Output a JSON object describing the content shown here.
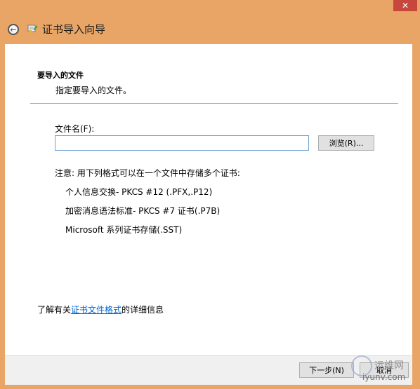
{
  "window": {
    "close_glyph": "✕"
  },
  "header": {
    "title": "证书导入向导",
    "back_glyph": "←"
  },
  "section": {
    "title": "要导入的文件",
    "subtitle": "指定要导入的文件。"
  },
  "form": {
    "file_label": "文件名(F):",
    "file_value": "",
    "browse_label": "浏览(R)..."
  },
  "note": {
    "heading": "注意: 用下列格式可以在一个文件中存储多个证书:",
    "formats": [
      "个人信息交换- PKCS #12 (.PFX,.P12)",
      "加密消息语法标准- PKCS #7 证书(.P7B)",
      "Microsoft 系列证书存储(.SST)"
    ]
  },
  "learn_more": {
    "prefix": "了解有关",
    "link": "证书文件格式",
    "suffix": "的详细信息"
  },
  "footer": {
    "next_label": "下一步(N)",
    "cancel_label": "取消"
  },
  "watermark": {
    "line1": "运维网",
    "line2": "iyunv.com"
  }
}
